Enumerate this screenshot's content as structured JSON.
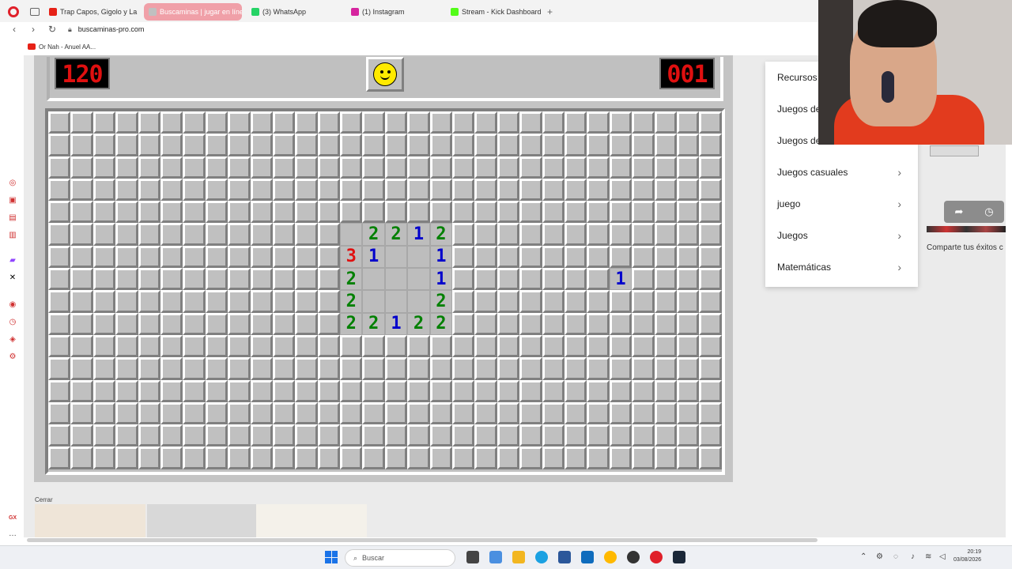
{
  "tabs": [
    {
      "label": "Trap Capos, Gigolo y La Ex",
      "color": "#e62117",
      "active": false
    },
    {
      "label": "Buscaminas | jugar en líne",
      "color": "#c0c0c0",
      "active": true
    },
    {
      "label": "(3) WhatsApp",
      "color": "#25d366",
      "active": false
    },
    {
      "label": "(1) Instagram",
      "color": "#d6249f",
      "active": false
    },
    {
      "label": "Stream - Kick Dashboard",
      "color": "#53fc18",
      "active": false
    }
  ],
  "address": {
    "url": "buscaminas-pro.com"
  },
  "bookmark": {
    "label": "Or Nah - Anuel AA..."
  },
  "game": {
    "mines_left": "120",
    "time": "001",
    "face": "smiley-icon",
    "rows": 16,
    "cols": 30,
    "revealed": [
      {
        "r": 5,
        "c": 13,
        "v": ""
      },
      {
        "r": 5,
        "c": 14,
        "v": "2"
      },
      {
        "r": 5,
        "c": 15,
        "v": "2"
      },
      {
        "r": 5,
        "c": 16,
        "v": "1"
      },
      {
        "r": 5,
        "c": 17,
        "v": "2"
      },
      {
        "r": 6,
        "c": 13,
        "v": "3"
      },
      {
        "r": 6,
        "c": 14,
        "v": "1"
      },
      {
        "r": 6,
        "c": 15,
        "v": ""
      },
      {
        "r": 6,
        "c": 16,
        "v": ""
      },
      {
        "r": 6,
        "c": 17,
        "v": "1"
      },
      {
        "r": 7,
        "c": 13,
        "v": "2"
      },
      {
        "r": 7,
        "c": 14,
        "v": ""
      },
      {
        "r": 7,
        "c": 15,
        "v": ""
      },
      {
        "r": 7,
        "c": 16,
        "v": ""
      },
      {
        "r": 7,
        "c": 17,
        "v": "1"
      },
      {
        "r": 8,
        "c": 13,
        "v": "2"
      },
      {
        "r": 8,
        "c": 14,
        "v": ""
      },
      {
        "r": 8,
        "c": 15,
        "v": ""
      },
      {
        "r": 8,
        "c": 16,
        "v": ""
      },
      {
        "r": 8,
        "c": 17,
        "v": "2"
      },
      {
        "r": 9,
        "c": 13,
        "v": "2"
      },
      {
        "r": 9,
        "c": 14,
        "v": "2"
      },
      {
        "r": 9,
        "c": 15,
        "v": "1"
      },
      {
        "r": 9,
        "c": 16,
        "v": "2"
      },
      {
        "r": 9,
        "c": 17,
        "v": "2"
      },
      {
        "r": 7,
        "c": 25,
        "v": "1"
      }
    ]
  },
  "menu": {
    "items": [
      "Recursos",
      "Juegos de",
      "Juegos de",
      "Juegos casuales",
      "juego",
      "Juegos",
      "Matemáticas"
    ]
  },
  "widget": {
    "share_text": "Comparte tus éxitos c"
  },
  "bottom": {
    "close_label": "Cerrar"
  },
  "taskbar": {
    "search_placeholder": "Buscar",
    "time": "20:19",
    "date": "03/08/2026"
  }
}
